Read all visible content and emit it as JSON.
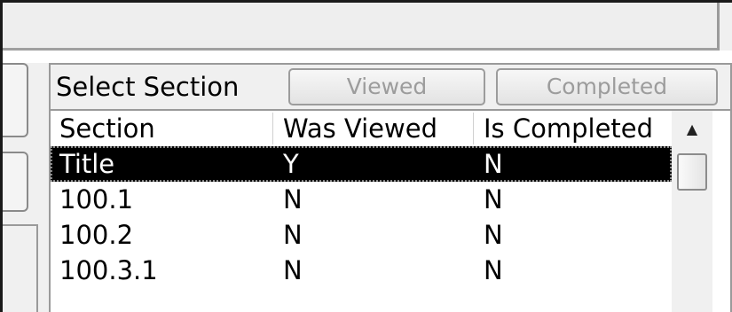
{
  "toolbar": {
    "select_label": "Select Section",
    "viewed_button": "Viewed",
    "completed_button": "Completed"
  },
  "table": {
    "columns": [
      "Section",
      "Was Viewed",
      "Is Completed"
    ],
    "rows": [
      [
        "Title",
        "Y",
        "N"
      ],
      [
        "100.1",
        "N",
        "N"
      ],
      [
        "100.2",
        "N",
        "N"
      ],
      [
        "100.3.1",
        "N",
        "N"
      ]
    ],
    "selected_row": 0
  },
  "scrollbar": {
    "up_arrow_icon": "triangle-up-icon"
  },
  "colors": {
    "selection_bg": "#000000",
    "disabled_text": "#9c9c9c"
  }
}
